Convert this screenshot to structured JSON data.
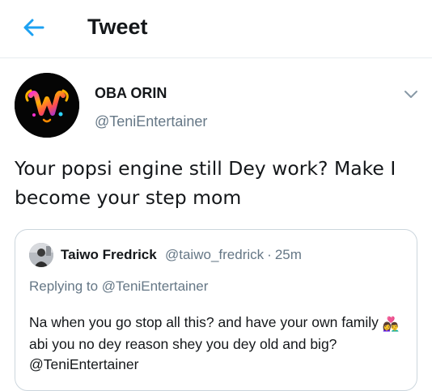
{
  "header": {
    "title": "Tweet",
    "back_icon": "arrow-left-icon",
    "accent_color": "#1da1f2"
  },
  "tweet": {
    "author": {
      "display_name": "OBA ORIN",
      "handle": "@TeniEntertainer",
      "avatar_letter": "W"
    },
    "text": "Your popsi engine still Dey work? Make I become your step mom",
    "more_icon": "chevron-down-icon"
  },
  "quote": {
    "author": {
      "display_name": "Taiwo Fredrick",
      "handle": "@taiwo_fredrick",
      "separator": "·",
      "time": "25m"
    },
    "replying_prefix": "Replying to",
    "replying_to": "@TeniEntertainer",
    "text_before_emoji": "Na when you go stop all this? and have your own family",
    "emoji": "👩‍❤️‍👨",
    "text_after_emoji": "abi you no dey reason shey you dey old and big?",
    "mention": "@TeniEntertainer"
  }
}
